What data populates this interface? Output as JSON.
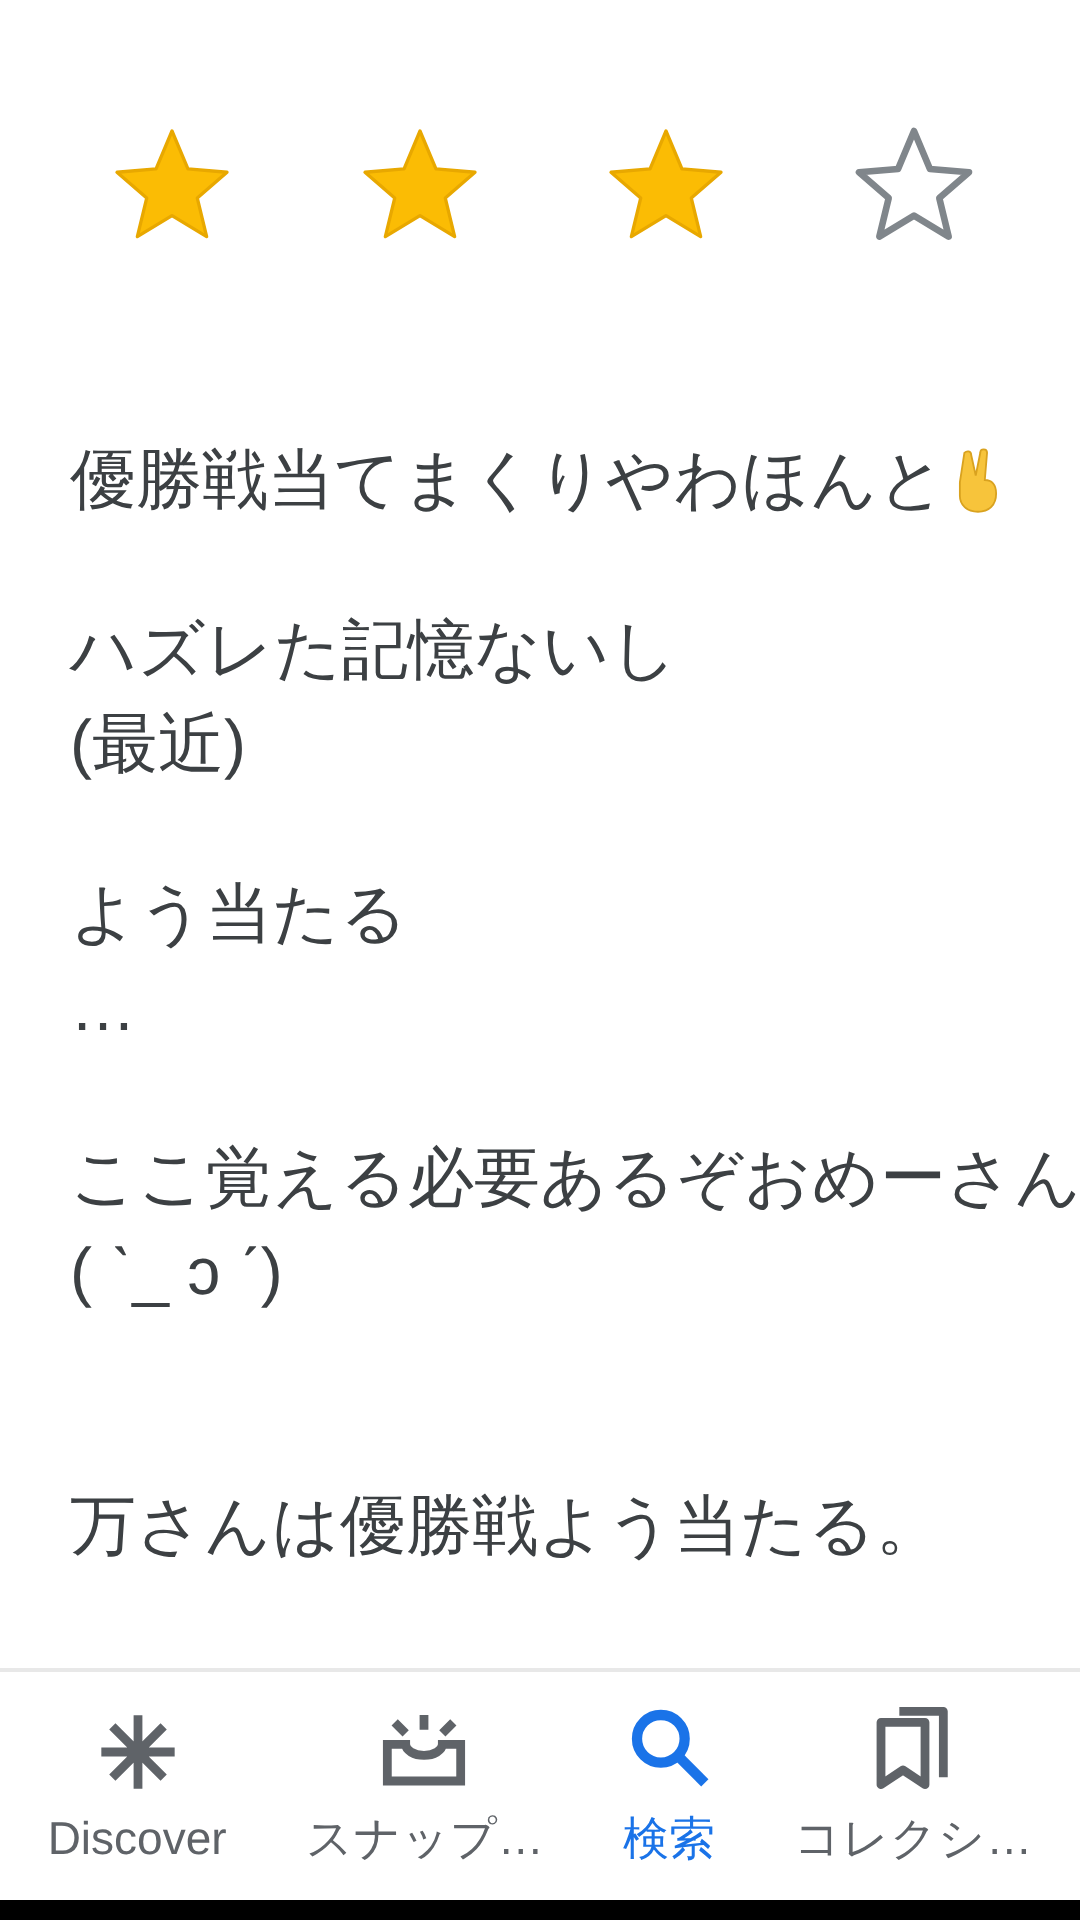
{
  "rating": {
    "stars": 3
  },
  "review": [
    {
      "lines": [
        "優勝戦当てまくりやわほんと"
      ],
      "kind": "peace"
    },
    {
      "lines": [
        "ハズレた記憶ないし",
        "(最近)"
      ],
      "kind": "plain"
    },
    {
      "lines": [
        "よう当たる",
        "…"
      ],
      "kind": "plain"
    },
    {
      "lines": [
        "ここ覚える必要あるぞおめーさん",
        "( ˋ_ ͻ ˊ)"
      ],
      "kind": "plain"
    },
    {
      "lines": [
        "万さんは優勝戦よう当たる。"
      ],
      "kind": "plain"
    }
  ],
  "bottom_nav": [
    {
      "label": "Discover",
      "kind": "discover",
      "selected": false
    },
    {
      "label": "スナップ…",
      "kind": "snap",
      "selected": false
    },
    {
      "label": "検索",
      "kind": "search",
      "selected": true
    },
    {
      "label": "コレクシ…",
      "kind": "collections",
      "selected": false
    }
  ]
}
